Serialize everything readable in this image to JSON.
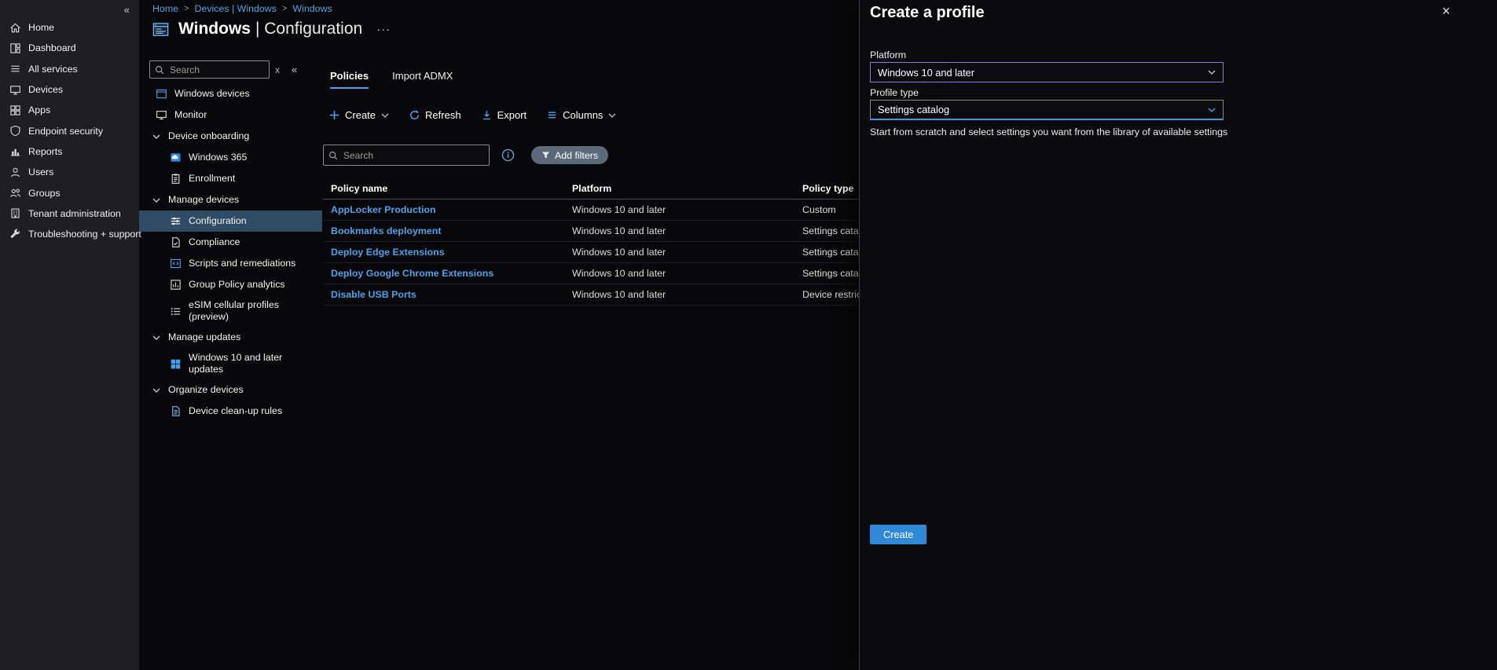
{
  "colors": {
    "accent_blue": "#479ef5",
    "link_blue": "#4da1e8",
    "breadcrumb_blue": "#4da2e0",
    "selected_nav_bg": "#2e4c63",
    "pill_bg": "#5a6a78",
    "platform_dropdown_border": "#8f7bd3",
    "profile_dropdown_underline": "#3e96e0",
    "create_button_bg": "#2f88d8",
    "sidebar_bg": "#1e1e23",
    "content_bg": "#08080a"
  },
  "sidebar": {
    "collapse_glyph": "«",
    "items": [
      {
        "label": "Home",
        "icon": "home-icon"
      },
      {
        "label": "Dashboard",
        "icon": "dashboard-icon"
      },
      {
        "label": "All services",
        "icon": "all-services-icon"
      },
      {
        "label": "Devices",
        "icon": "devices-icon"
      },
      {
        "label": "Apps",
        "icon": "apps-icon"
      },
      {
        "label": "Endpoint security",
        "icon": "shield-icon"
      },
      {
        "label": "Reports",
        "icon": "reports-icon"
      },
      {
        "label": "Users",
        "icon": "user-icon"
      },
      {
        "label": "Groups",
        "icon": "groups-icon"
      },
      {
        "label": "Tenant administration",
        "icon": "building-icon"
      },
      {
        "label": "Troubleshooting + support",
        "icon": "wrench-icon"
      }
    ]
  },
  "breadcrumb": {
    "separator": ">",
    "items": [
      "Home",
      "Devices | Windows",
      "Windows"
    ]
  },
  "page": {
    "title_bold": "Windows",
    "title_rest": "| Configuration",
    "more_glyph": "···"
  },
  "nav": {
    "search_placeholder": "Search",
    "search_clear_glyph": "x",
    "collapse_glyph": "«",
    "items": [
      {
        "label": "Windows devices",
        "icon": "windows-devices-icon",
        "kind": "item"
      },
      {
        "label": "Monitor",
        "icon": "monitor-icon",
        "kind": "item"
      },
      {
        "label": "Device onboarding",
        "icon": "chevron-down-icon",
        "kind": "group",
        "expanded": true
      },
      {
        "label": "Windows 365",
        "icon": "windows-365-icon",
        "kind": "child"
      },
      {
        "label": "Enrollment",
        "icon": "enrollment-icon",
        "kind": "child"
      },
      {
        "label": "Manage devices",
        "icon": "chevron-down-icon",
        "kind": "group",
        "expanded": true
      },
      {
        "label": "Configuration",
        "icon": "configuration-icon",
        "kind": "child",
        "selected": true
      },
      {
        "label": "Compliance",
        "icon": "compliance-icon",
        "kind": "child"
      },
      {
        "label": "Scripts and remediations",
        "icon": "scripts-icon",
        "kind": "child"
      },
      {
        "label": "Group Policy analytics",
        "icon": "group-policy-analytics-icon",
        "kind": "child"
      },
      {
        "label": "eSIM cellular profiles (preview)",
        "icon": "esim-icon",
        "kind": "child"
      },
      {
        "label": "Manage updates",
        "icon": "chevron-down-icon",
        "kind": "group",
        "expanded": true
      },
      {
        "label": "Windows 10 and later updates",
        "icon": "windows-updates-icon",
        "kind": "child"
      },
      {
        "label": "Organize devices",
        "icon": "chevron-down-icon",
        "kind": "group",
        "expanded": true
      },
      {
        "label": "Device clean-up rules",
        "icon": "device-cleanup-icon",
        "kind": "child"
      }
    ]
  },
  "main": {
    "tabs": [
      {
        "label": "Policies",
        "active": true
      },
      {
        "label": "Import ADMX",
        "active": false
      }
    ],
    "toolbar": {
      "create": "Create",
      "refresh": "Refresh",
      "export": "Export",
      "columns": "Columns"
    },
    "search_placeholder": "Search",
    "add_filters_label": "Add filters",
    "table": {
      "columns": [
        "Policy name",
        "Platform",
        "Policy type"
      ],
      "rows": [
        {
          "name": "AppLocker Production",
          "platform": "Windows 10 and later",
          "type": "Custom"
        },
        {
          "name": "Bookmarks deployment",
          "platform": "Windows 10 and later",
          "type": "Settings catalog"
        },
        {
          "name": "Deploy Edge Extensions",
          "platform": "Windows 10 and later",
          "type": "Settings catalog"
        },
        {
          "name": "Deploy Google Chrome Extensions",
          "platform": "Windows 10 and later",
          "type": "Settings catalog"
        },
        {
          "name": "Disable USB Ports",
          "platform": "Windows 10 and later",
          "type": "Device restrictions"
        }
      ]
    }
  },
  "flyout": {
    "title": "Create a profile",
    "close_glyph": "×",
    "platform_label": "Platform",
    "platform_value": "Windows 10 and later",
    "profile_type_label": "Profile type",
    "profile_type_value": "Settings catalog",
    "description": "Start from scratch and select settings you want from the library of available settings",
    "create_label": "Create"
  }
}
